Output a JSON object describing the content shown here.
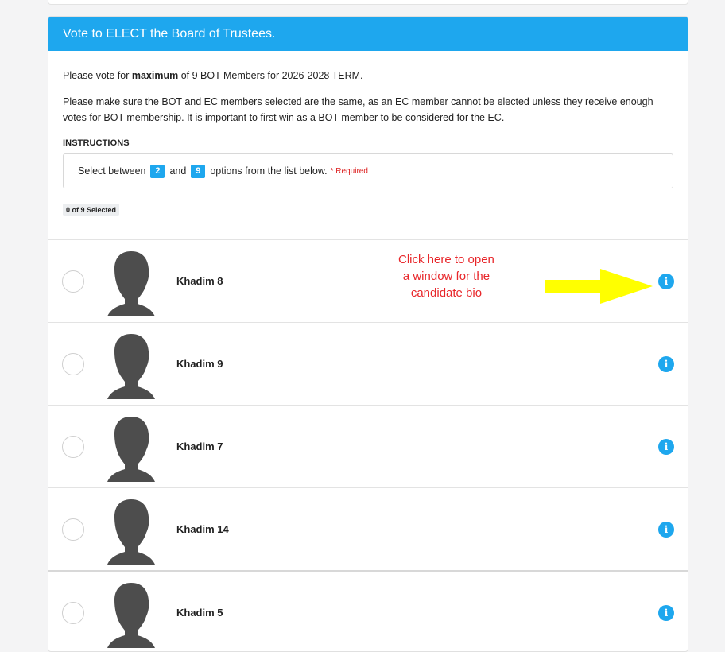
{
  "card": {
    "title": "Vote to ELECT the Board of Trustees.",
    "line1_pre": "Please vote for ",
    "line1_bold": "maximum",
    "line1_post": " of 9 BOT Members for 2026-2028 TERM.",
    "line2": "Please make sure the BOT and EC members selected are the same, as an EC member cannot be elected unless they receive enough votes for BOT membership. It is important to first win as a BOT member to be considered for the EC.",
    "instructions_title": "INSTRUCTIONS",
    "instr_pre": "Select between",
    "instr_min": "2",
    "instr_and": "and",
    "instr_max": "9",
    "instr_post": "options from the list below.",
    "required": "* Required",
    "selected_count": "0 of 9 Selected"
  },
  "annotation": {
    "line1": "Click here to open",
    "line2": "a window for the",
    "line3": "candidate bio",
    "arrow_color": "#ffff00"
  },
  "candidates": [
    {
      "name": "Khadim 8"
    },
    {
      "name": "Khadim 9"
    },
    {
      "name": "Khadim 7"
    },
    {
      "name": "Khadim 14"
    },
    {
      "name": "Khadim 5"
    }
  ],
  "colors": {
    "header_blue": "#1ea7ee",
    "required_red": "#d22222",
    "avatar_gray": "#4d4d4d"
  }
}
